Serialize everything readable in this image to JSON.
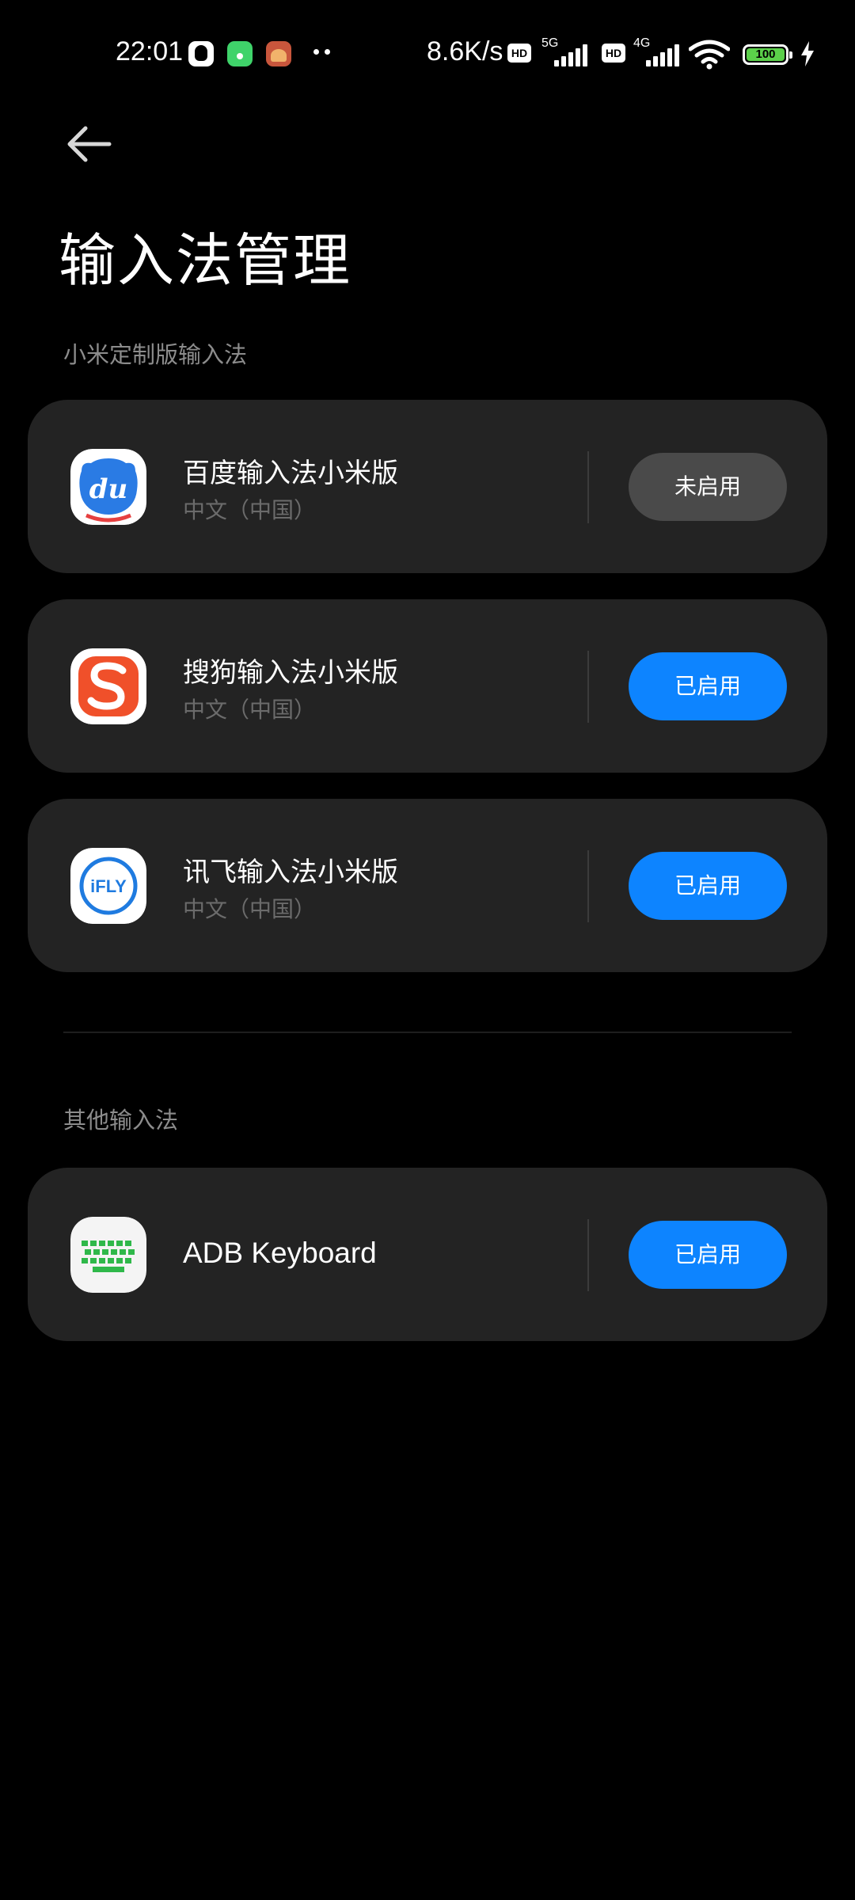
{
  "status_bar": {
    "time": "22:01",
    "net_speed": "8.6K/s",
    "hd_label": "HD",
    "network_5g": "5G",
    "network_4g": "4G",
    "battery_level": "100",
    "notification_icons": [
      "qq-icon",
      "green-app-icon",
      "game-app-icon"
    ],
    "status_icons": [
      "hd-icon",
      "signal-5g-icon",
      "hd-icon",
      "signal-4g-icon",
      "wifi-icon",
      "battery-icon",
      "charging-icon"
    ]
  },
  "header": {
    "back_icon": "back-arrow-icon",
    "title": "输入法管理"
  },
  "sections": [
    {
      "label": "小米定制版输入法",
      "items": [
        {
          "icon": "baidu-input-icon",
          "name": "百度输入法小米版",
          "subtitle": "中文（中国）",
          "status": "未启用",
          "enabled": false
        },
        {
          "icon": "sogou-input-icon",
          "name": "搜狗输入法小米版",
          "subtitle": "中文（中国）",
          "status": "已启用",
          "enabled": true
        },
        {
          "icon": "ifly-input-icon",
          "name": "讯飞输入法小米版",
          "subtitle": "中文（中国）",
          "status": "已启用",
          "enabled": true
        }
      ]
    },
    {
      "label": "其他输入法",
      "items": [
        {
          "icon": "adb-keyboard-icon",
          "name": "ADB Keyboard",
          "status": "已启用",
          "enabled": true
        }
      ]
    }
  ],
  "app_icon_text": {
    "baidu": "du",
    "ifly": "iFLY"
  },
  "colors": {
    "background": "#000000",
    "card": "#232323",
    "enabled_button": "#0d84ff",
    "disabled_button": "#4a4a4a",
    "section_label": "#8c8c8c",
    "subtitle": "#6b6b6b"
  }
}
